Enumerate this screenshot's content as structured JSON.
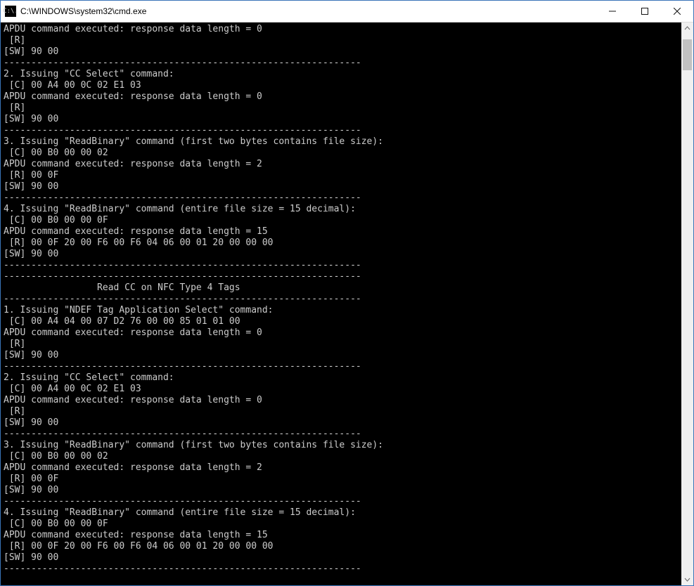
{
  "window": {
    "icon_text": "C:\\.",
    "title": "C:\\WINDOWS\\system32\\cmd.exe"
  },
  "terminal": {
    "lines": [
      "APDU command executed: response data length = 0",
      " [R]",
      "[SW] 90 00",
      "-----------------------------------------------------------------",
      "2. Issuing \"CC Select\" command:",
      " [C] 00 A4 00 0C 02 E1 03",
      "APDU command executed: response data length = 0",
      " [R]",
      "[SW] 90 00",
      "-----------------------------------------------------------------",
      "3. Issuing \"ReadBinary\" command (first two bytes contains file size):",
      " [C] 00 B0 00 00 02",
      "APDU command executed: response data length = 2",
      " [R] 00 0F",
      "[SW] 90 00",
      "-----------------------------------------------------------------",
      "4. Issuing \"ReadBinary\" command (entire file size = 15 decimal):",
      " [C] 00 B0 00 00 0F",
      "APDU command executed: response data length = 15",
      " [R] 00 0F 20 00 F6 00 F6 04 06 00 01 20 00 00 00",
      "[SW] 90 00",
      "-----------------------------------------------------------------",
      "-----------------------------------------------------------------",
      "                 Read CC on NFC Type 4 Tags",
      "-----------------------------------------------------------------",
      "1. Issuing \"NDEF Tag Application Select\" command:",
      " [C] 00 A4 04 00 07 D2 76 00 00 85 01 01 00",
      "APDU command executed: response data length = 0",
      " [R]",
      "[SW] 90 00",
      "-----------------------------------------------------------------",
      "2. Issuing \"CC Select\" command:",
      " [C] 00 A4 00 0C 02 E1 03",
      "APDU command executed: response data length = 0",
      " [R]",
      "[SW] 90 00",
      "-----------------------------------------------------------------",
      "3. Issuing \"ReadBinary\" command (first two bytes contains file size):",
      " [C] 00 B0 00 00 02",
      "APDU command executed: response data length = 2",
      " [R] 00 0F",
      "[SW] 90 00",
      "-----------------------------------------------------------------",
      "4. Issuing \"ReadBinary\" command (entire file size = 15 decimal):",
      " [C] 00 B0 00 00 0F",
      "APDU command executed: response data length = 15",
      " [R] 00 0F 20 00 F6 00 F6 04 06 00 01 20 00 00 00",
      "[SW] 90 00",
      "-----------------------------------------------------------------"
    ]
  }
}
